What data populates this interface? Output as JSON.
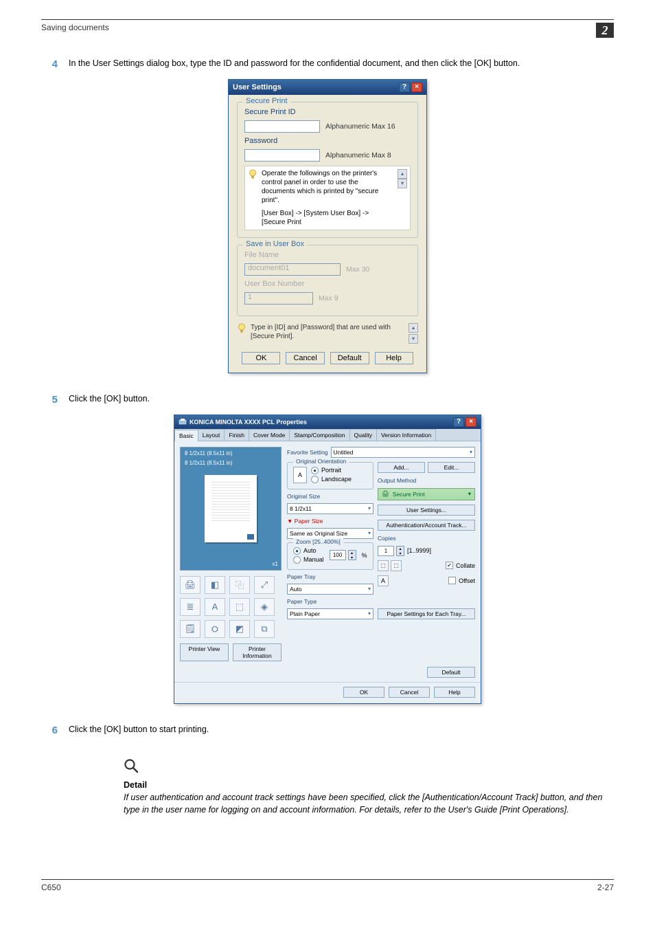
{
  "header": {
    "section_title": "Saving documents",
    "chapter": "2"
  },
  "steps": {
    "s4": {
      "num": "4",
      "text": "In the User Settings dialog box, type the ID and password for the confidential document, and then click the [OK] button."
    },
    "s5": {
      "num": "5",
      "text": "Click the [OK] button."
    },
    "s6": {
      "num": "6",
      "text": "Click the [OK] button to start printing."
    }
  },
  "user_settings": {
    "title": "User Settings",
    "secure_group": "Secure Print",
    "id_label": "Secure Print ID",
    "id_hint": "Alphanumeric Max 16",
    "pw_label": "Password",
    "pw_hint": "Alphanumeric Max 8",
    "info1": "Operate the followings on the printer's control panel in order to use the documents which is printed by \"secure print\".",
    "info2": "[User Box] -> [System User Box] -> [Secure Print",
    "save_group": "Save in User Box",
    "file_label": "File Name",
    "file_value": "document01",
    "file_hint": "Max 30",
    "box_label": "User Box Number",
    "box_value": "1",
    "box_hint": "Max 9",
    "note": "Type in [ID] and [Password] that are used with [Secure Print].",
    "btn_ok": "OK",
    "btn_cancel": "Cancel",
    "btn_default": "Default",
    "btn_help": "Help"
  },
  "print_props": {
    "title": "KONICA MINOLTA XXXX PCL Properties",
    "tabs": [
      "Basic",
      "Layout",
      "Finish",
      "Cover Mode",
      "Stamp/Composition",
      "Quality",
      "Version Information"
    ],
    "preview_size": "8 1/2x11 (8.5x11 in)",
    "pv_btn1": "Printer View",
    "pv_btn2": "Printer Information",
    "favorite_label": "Favorite Setting",
    "favorite_value": "Untitled",
    "add_btn": "Add...",
    "edit_btn": "Edit...",
    "orient_legend": "Original Orientation",
    "orient_portrait": "Portrait",
    "orient_landscape": "Landscape",
    "orig_size_label": "Original Size",
    "orig_size_value": "8 1/2x11",
    "paper_size_label": "Paper Size",
    "paper_size_value": "Same as Original Size",
    "zoom_legend": "Zoom [25..400%]",
    "zoom_auto": "Auto",
    "zoom_manual": "Manual",
    "zoom_value": "100",
    "zoom_unit": "%",
    "tray_label": "Paper Tray",
    "tray_value": "Auto",
    "type_label": "Paper Type",
    "type_value": "Plain Paper",
    "output_label": "Output Method",
    "output_value": "Secure Print",
    "user_settings_btn": "User Settings...",
    "auth_btn": "Authentication/Account Track...",
    "copies_label": "Copies",
    "copies_value": "1",
    "copies_range": "[1..9999]",
    "collate": "Collate",
    "offset": "Offset",
    "per_tray_btn": "Paper Settings for Each Tray...",
    "default_btn": "Default",
    "ok": "OK",
    "cancel": "Cancel",
    "help": "Help"
  },
  "detail": {
    "heading": "Detail",
    "text": "If user authentication and account track settings have been specified, click the [Authentication/Account Track] button, and then type in the user name for logging on and account information. For details, refer to the User's Guide [Print Operations]."
  },
  "footer": {
    "left": "C650",
    "right": "2-27"
  }
}
